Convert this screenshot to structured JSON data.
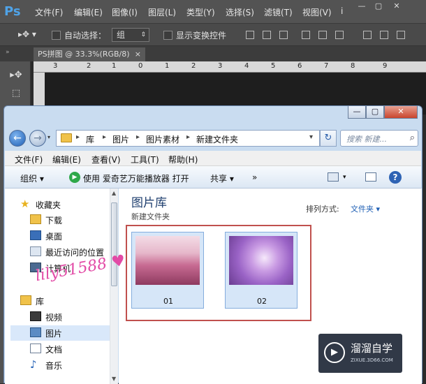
{
  "photoshop": {
    "logo": "Ps",
    "menus": [
      "文件(F)",
      "编辑(E)",
      "图像(I)",
      "图层(L)",
      "类型(Y)",
      "选择(S)",
      "滤镜(T)",
      "视图(V)"
    ],
    "options": {
      "auto_select": "自动选择：",
      "auto_select_value": "组",
      "show_transform": "显示变换控件"
    },
    "doc_tab": "PS拼图 @ 33.3%(RGB/8)",
    "ruler_numbers": [
      "3",
      "2",
      "1",
      "0",
      "1",
      "2",
      "3",
      "4",
      "5",
      "6",
      "7",
      "8",
      "9"
    ]
  },
  "explorer": {
    "breadcrumb": [
      "库",
      "图片",
      "图片素材",
      "新建文件夹"
    ],
    "search_placeholder": "搜索 新建...",
    "menu": [
      "文件(F)",
      "编辑(E)",
      "查看(V)",
      "工具(T)",
      "帮助(H)"
    ],
    "commands": {
      "organize": "组织 ▾",
      "play_with": "使用 爱奇艺万能播放器 打开",
      "share": "共享 ▾",
      "more": "»"
    },
    "nav": {
      "favorites": "收藏夹",
      "downloads": "下载",
      "desktop": "桌面",
      "recent": "最近访问的位置",
      "computer": "计算机",
      "libraries": "库",
      "videos": "视频",
      "pictures": "图片",
      "documents": "文档",
      "music": "音乐"
    },
    "library_title": "图片库",
    "library_subtitle": "新建文件夹",
    "arrange_label": "排列方式:",
    "arrange_value": "文件夹 ▾",
    "files": [
      {
        "name": "01"
      },
      {
        "name": "02"
      }
    ]
  },
  "watermarks": {
    "handwritten": "lily51588",
    "brand": "溜溜自学",
    "brand_url": "ZIXUE.3D66.COM"
  }
}
